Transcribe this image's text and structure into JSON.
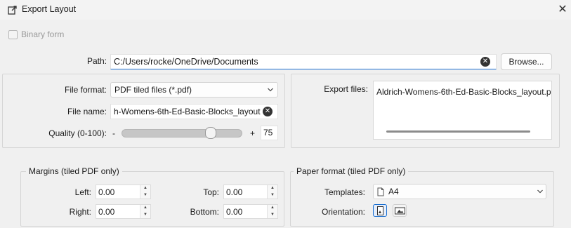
{
  "window": {
    "title": "Export Layout",
    "close_glyph": "✕",
    "icon": "export-icon"
  },
  "binary_form": {
    "label": "Binary form",
    "checked": false,
    "enabled": false
  },
  "path": {
    "label": "Path:",
    "value": "C:/Users/rocke/OneDrive/Documents",
    "browse_label": "Browse..."
  },
  "file_group": {
    "format_label": "File format:",
    "format_value": "PDF tiled files (*.pdf)",
    "name_label": "File name:",
    "name_value": "h-Womens-6th-Ed-Basic-Blocks_layout",
    "quality_label": "Quality (0-100):",
    "quality_minus": "-",
    "quality_plus": "+",
    "quality_value": "75",
    "quality_level": 0.75
  },
  "export_files": {
    "label": "Export files:",
    "items": [
      "Aldrich-Womens-6th-Ed-Basic-Blocks_layout.p"
    ]
  },
  "margins": {
    "title": "Margins (tiled PDF only)",
    "left_label": "Left:",
    "left_value": "0.00",
    "top_label": "Top:",
    "top_value": "0.00",
    "right_label": "Right:",
    "right_value": "0.00",
    "bottom_label": "Bottom:",
    "bottom_value": "0.00"
  },
  "paper": {
    "title": "Paper format (tiled PDF only)",
    "templates_label": "Templates:",
    "templates_value": "A4",
    "orientation_label": "Orientation:",
    "orientation_selected": "portrait"
  },
  "colors": {
    "accent": "#1a6fd1",
    "window_bg": "#f0f0f0"
  }
}
